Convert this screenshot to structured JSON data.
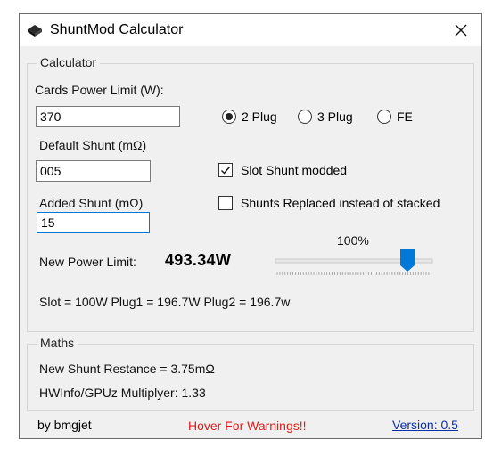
{
  "window": {
    "title": "ShuntMod Calculator",
    "close_icon": "close-icon",
    "app_icon": "app-icon"
  },
  "calculator": {
    "legend": "Calculator",
    "power_limit_label": "Cards Power Limit (W):",
    "power_limit_value": "370",
    "default_shunt_label": "Default Shunt (mΩ)",
    "default_shunt_value": "005",
    "added_shunt_label": "Added Shunt (mΩ)",
    "added_shunt_value": "15",
    "plug_options": [
      {
        "label": "2 Plug",
        "selected": true
      },
      {
        "label": "3 Plug",
        "selected": false
      },
      {
        "label": "FE",
        "selected": false
      }
    ],
    "slot_shunt_label": "Slot Shunt modded",
    "slot_shunt_checked": true,
    "shunts_replaced_label": "Shunts Replaced instead of stacked",
    "shunts_replaced_checked": false,
    "slider_percent_label": "100%",
    "slider_value": 1.0,
    "new_power_label": "New Power Limit:",
    "new_power_value": "493.34W",
    "breakdown": "Slot = 100W Plug1 = 196.7W Plug2 = 196.7w"
  },
  "maths": {
    "legend": "Maths",
    "shunt_resistance": "New Shunt Restance = 3.75mΩ",
    "multiplier": "HWInfo/GPUz Multiplyer: 1.33"
  },
  "footer": {
    "author": "by bmgjet",
    "warning": "Hover For Warnings!!",
    "version": "Version:  0.5"
  },
  "colors": {
    "accent": "#0078d7",
    "warning": "#e21a1a",
    "link": "#0a2fa3"
  }
}
